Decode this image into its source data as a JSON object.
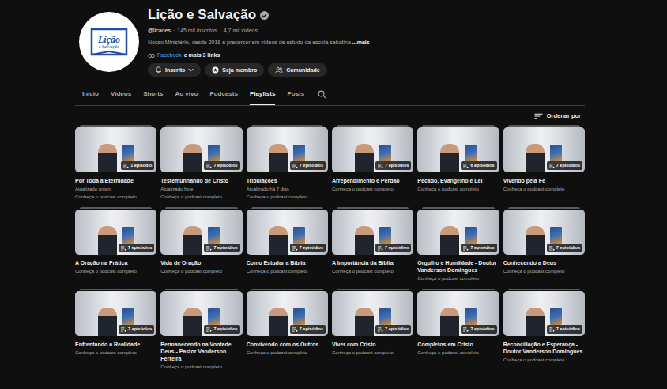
{
  "channel": {
    "name": "Lição e Salvação",
    "verified": true,
    "handle": "@licaoes",
    "separator": "·",
    "subscribers": "145 mil inscritos",
    "videos": "4,7 mil vídeos",
    "description": "Nosso Ministério, desde 2016 é precursor em vídeos de estudo da escola sabatina",
    "more": "...mais",
    "link_first": "Facebook",
    "link_rest": "e mais 3 links",
    "logo": {
      "line1": "Lição",
      "line2": "e Salvação"
    }
  },
  "buttons": [
    {
      "label": "Inscrito",
      "kind": "subscribed"
    },
    {
      "label": "Seja membro",
      "kind": "join"
    },
    {
      "label": "Comunidade",
      "kind": "community"
    }
  ],
  "tabs": [
    {
      "label": "Início",
      "selected": false
    },
    {
      "label": "Vídeos",
      "selected": false
    },
    {
      "label": "Shorts",
      "selected": false
    },
    {
      "label": "Ao vivo",
      "selected": false
    },
    {
      "label": "Podcasts",
      "selected": false
    },
    {
      "label": "Playlists",
      "selected": true
    },
    {
      "label": "Posts",
      "selected": false
    }
  ],
  "sort": {
    "label": "Ordenar por"
  },
  "playlists": [
    {
      "title": "Por Toda a Eternidade",
      "episodes": "1 episódio",
      "lines": [
        "Atualizado ontem",
        "Conheça o podcast completo"
      ]
    },
    {
      "title": "Testemunhando de Cristo",
      "episodes": "7 episódios",
      "lines": [
        "Atualizado hoje",
        "Conheça o podcast completo"
      ]
    },
    {
      "title": "Tribulações",
      "episodes": "7 episódios",
      "lines": [
        "Atualizado há 7 dias",
        "Conheça o podcast completo"
      ]
    },
    {
      "title": "Arrependimento e Perdão",
      "episodes": "7 episódios",
      "lines": [
        "Conheça o podcast completo"
      ]
    },
    {
      "title": "Pecado, Evangelho e Lei",
      "episodes": "6 episódios",
      "lines": [
        "Conheça o podcast completo"
      ]
    },
    {
      "title": "Vivendo pela Fé",
      "episodes": "7 episódios",
      "lines": [
        "Conheça o podcast completo"
      ]
    },
    {
      "title": "A Oração na Prática",
      "episodes": "7 episódios",
      "lines": [
        "Conheça o podcast completo"
      ]
    },
    {
      "title": "Vida de Oração",
      "episodes": "7 episódios",
      "lines": [
        "Conheça o podcast completo"
      ]
    },
    {
      "title": "Como Estudar a Bíblia",
      "episodes": "7 episódios",
      "lines": [
        "Conheça o podcast completo"
      ]
    },
    {
      "title": "A Importância da Bíblia",
      "episodes": "7 episódios",
      "lines": [
        "Conheça o podcast completo"
      ]
    },
    {
      "title": "Orgulho e Humildade - Doutor Vanderson Domingues",
      "episodes": "7 episódios",
      "lines": [
        "Conheça o podcast completo"
      ]
    },
    {
      "title": "Conhecendo a Deus",
      "episodes": "7 episódios",
      "lines": [
        "Conheça o podcast completo"
      ]
    },
    {
      "title": "Enfrentando a Realidade",
      "episodes": "7 episódios",
      "lines": [
        "Conheça o podcast completo"
      ]
    },
    {
      "title": "Permanecendo na Vontade Deus - Pastor Vanderson Ferreira",
      "episodes": "7 episódios",
      "lines": [
        "Conheça o podcast completo"
      ]
    },
    {
      "title": "Convivendo com os Outros",
      "episodes": "7 episódios",
      "lines": [
        "Conheça o podcast completo"
      ]
    },
    {
      "title": "Viver com Cristo",
      "episodes": "7 episódios",
      "lines": [
        "Conheça o podcast completo"
      ]
    },
    {
      "title": "Completos em Cristo",
      "episodes": "7 episódios",
      "lines": [
        "Conheça o podcast completo"
      ]
    },
    {
      "title": "Reconciliação e Esperança - Doutor Vanderson Domingues",
      "episodes": "7 episódios",
      "lines": [
        "Conheça o podcast completo"
      ]
    }
  ]
}
